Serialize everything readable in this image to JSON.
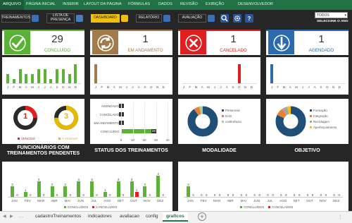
{
  "ribbon": {
    "tabs": [
      "ARQUIVO",
      "PÁGINA INICIAL",
      "INSERIR",
      "LAYOUT DA PÁGINA",
      "FÓRMULAS",
      "DADOS",
      "REVISÃO",
      "EXIBIÇÃO",
      "DESENVOLVEDOR"
    ]
  },
  "toolbar": {
    "treinamentos": "TREINAMENTOS",
    "lista1": "LISTA DE",
    "lista2": "PRESENÇA",
    "dashboard": "DASHBOARD",
    "relatorio": "RELATÓRIO",
    "avaliacao": "AVALIAÇÃO",
    "filter_value": "TODOS",
    "filter_label": "SELECIONE O ANO"
  },
  "kpis": [
    {
      "value": "29",
      "label": "CONCLUÍDO",
      "color": "#5bb236",
      "icon": "check"
    },
    {
      "value": "1",
      "label": "EM ANDAMENTO",
      "color": "#a27b4b",
      "icon": "cycle"
    },
    {
      "value": "1",
      "label": "CANCELADO",
      "color": "#e02020",
      "icon": "close"
    },
    {
      "value": "1",
      "label": "AGENDADO",
      "color": "#2b6bb0",
      "icon": "down-arrow"
    }
  ],
  "months_short": [
    "J",
    "F",
    "M",
    "A",
    "M",
    "J",
    "J",
    "A",
    "S",
    "O",
    "N",
    "D"
  ],
  "mini_charts": [
    {
      "color": "#5bb236",
      "values": [
        2,
        1,
        3,
        2,
        2,
        3,
        3,
        1,
        3,
        3,
        2,
        4
      ]
    },
    {
      "color": "#a27b4b",
      "values": [
        1,
        0,
        0,
        0,
        0,
        0,
        0,
        0,
        0,
        0,
        0,
        0
      ]
    },
    {
      "color": "#e02020",
      "values": [
        0,
        0,
        0,
        0,
        0,
        0,
        0,
        0,
        0,
        1,
        0,
        0
      ]
    },
    {
      "color": "#2b6bb0",
      "values": [
        1,
        0,
        0,
        0,
        0,
        0,
        0,
        0,
        0,
        0,
        0,
        0
      ]
    }
  ],
  "pendentes": {
    "title": "FUNCIONÁRIOS COM TREINAMENTOS PENDENTES",
    "vencido": {
      "value": "1",
      "label": "VENCIDO",
      "fraction": 0.25,
      "color": "#e02020"
    },
    "avencer": {
      "value": "3",
      "label": "A VENCER",
      "fraction": 0.75,
      "color": "#e6b800"
    }
  },
  "status": {
    "title": "STATUS DOS TREINAMENTOS",
    "chart_data": {
      "type": "bar",
      "orientation": "horizontal",
      "categories": [
        "AGENDADO",
        "CANCELADO",
        "EM ANDAMENTO",
        "CONCLUÍDO"
      ],
      "values": [
        1,
        1,
        1,
        29
      ],
      "colors": [
        "#2b6bb0",
        "#e02020",
        "#a27b4b",
        "#5bb236"
      ],
      "xlim": [
        0,
        40
      ],
      "ticks": [
        "0",
        "10",
        "20",
        "30",
        "40"
      ]
    }
  },
  "modalidade": {
    "title": "MODALIDADE",
    "chart_data": {
      "type": "pie",
      "labels": [
        "Presencial",
        "EAD",
        "conferência"
      ],
      "values": [
        90,
        6,
        4
      ],
      "colors": [
        "#1f4e79",
        "#ed7d31",
        "#a9d18e"
      ]
    }
  },
  "objetivo": {
    "title": "OBJETIVO",
    "chart_data": {
      "type": "pie",
      "labels": [
        "Formação",
        "Integração",
        "Reciclagem",
        "Aperfeiçoamento"
      ],
      "values": [
        82,
        8,
        6,
        4
      ],
      "colors": [
        "#1f4e79",
        "#ed7d31",
        "#a5a5a5",
        "#ffc000"
      ]
    }
  },
  "bottom_left": {
    "months": [
      "JAN",
      "FEV",
      "MAR",
      "ABR",
      "MAI",
      "JUN",
      "JUL",
      "AGO",
      "SET",
      "OUT",
      "NOV",
      "DEZ"
    ],
    "chart_data": {
      "type": "bar",
      "series": [
        {
          "name": "CONCLUÍDOS",
          "color": "#5bb236",
          "values": [
            2,
            1,
            3,
            2,
            2,
            3,
            3,
            1,
            3,
            3,
            2,
            4
          ]
        },
        {
          "name": "CANCELADOS",
          "color": "#e02020",
          "values": [
            0,
            0,
            0,
            0,
            0,
            0,
            0,
            0,
            0,
            1,
            0,
            0
          ]
        }
      ]
    }
  },
  "bottom_right": {
    "months": [
      "JAN",
      "FEV",
      "MAR",
      "ABR",
      "MAI",
      "JUN",
      "JUL",
      "AGO",
      "SET",
      "OUT",
      "NOV",
      "DEZ"
    ],
    "chart_data": {
      "type": "bar",
      "series": [
        {
          "name": "CONCLUÍDOS",
          "color": "#5bb236",
          "values": [
            2,
            0,
            0,
            0,
            0,
            0,
            0,
            0,
            0,
            0,
            0,
            0
          ]
        },
        {
          "name": "CANCELADOS",
          "color": "#e02020",
          "values": [
            0,
            0,
            0,
            0,
            0,
            0,
            0,
            0,
            0,
            0,
            0,
            0
          ]
        }
      ]
    }
  },
  "sheets": [
    "cadastroTreinamentos",
    "indicadores",
    "avaliacao",
    "config",
    "graficos"
  ],
  "active_sheet": "graficos"
}
